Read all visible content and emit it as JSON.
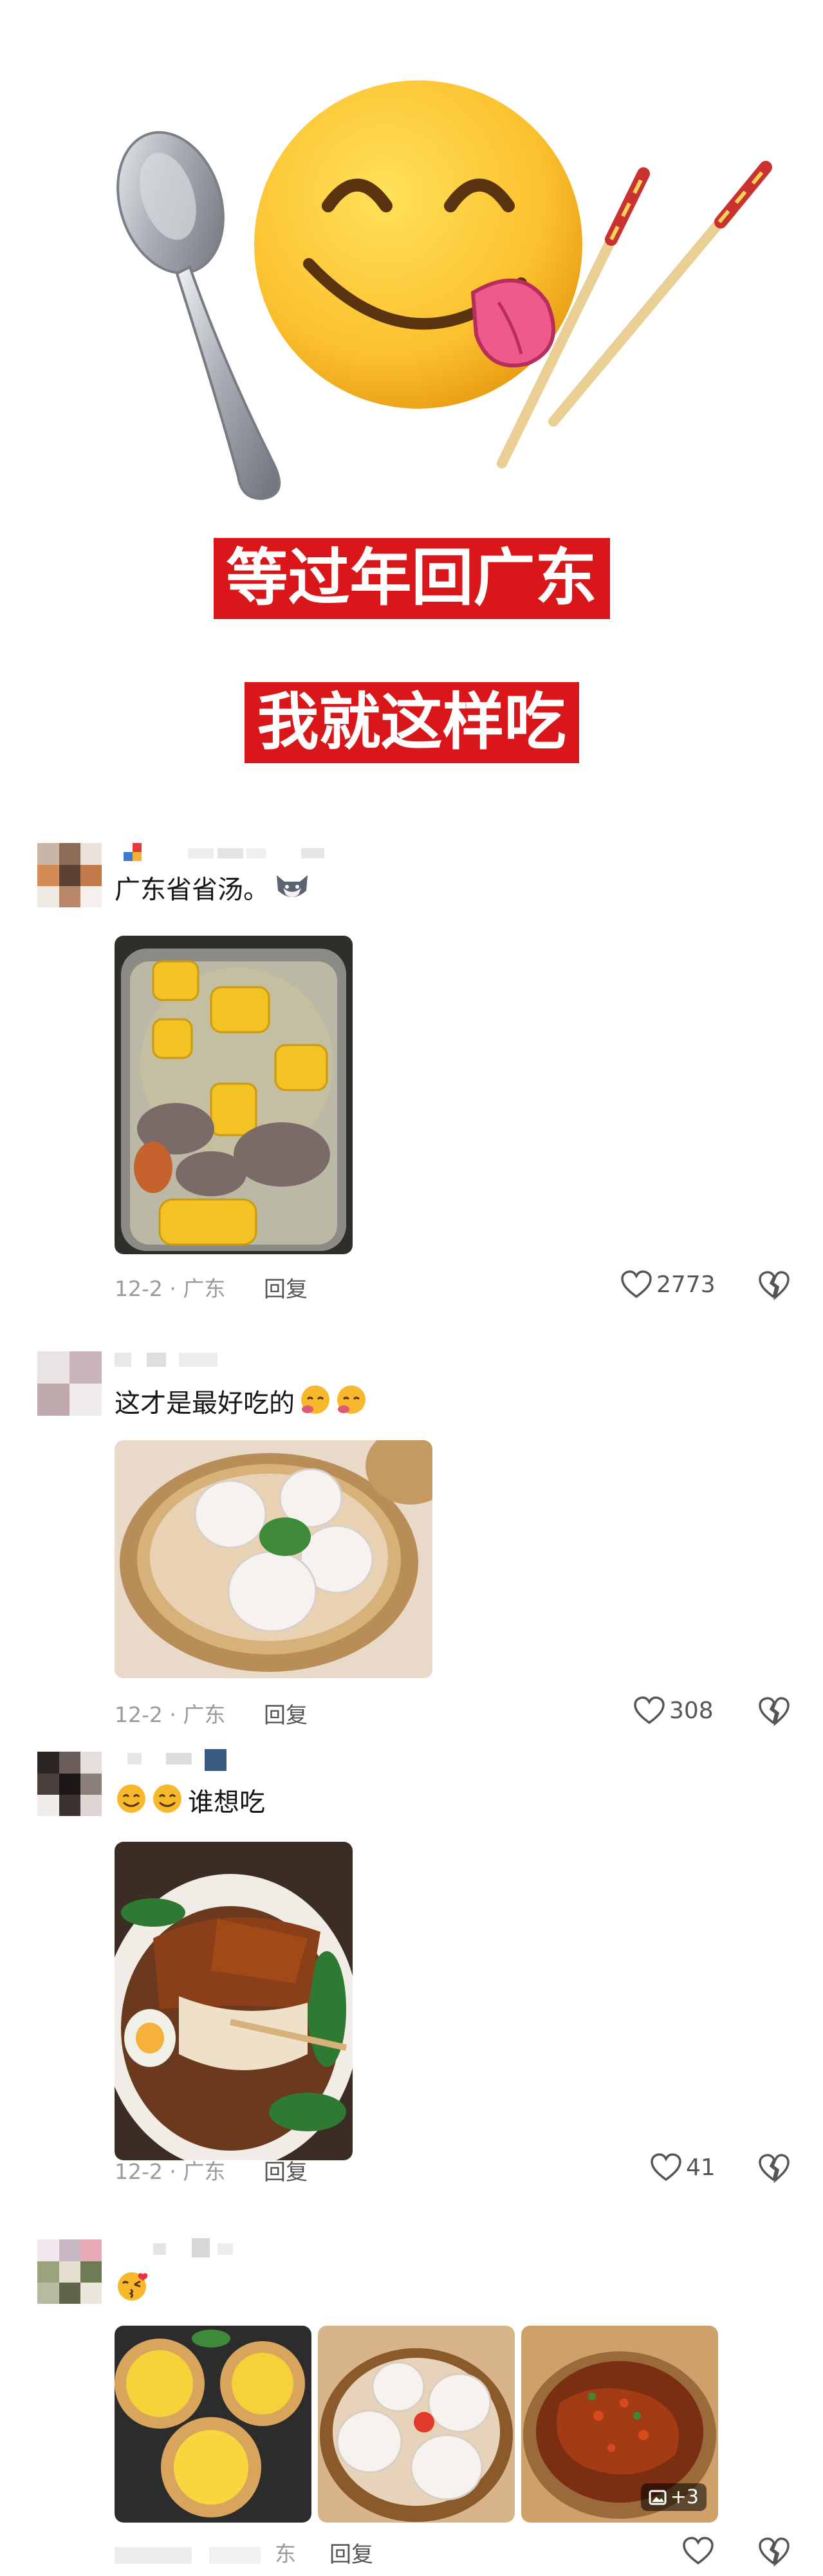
{
  "titles": [
    "等过年回广东",
    "我就这样吃"
  ],
  "colors": {
    "title_bg": "#d9161a",
    "meta": "#9a9a9a",
    "text": "#161616"
  },
  "comments": [
    {
      "text": "广东省省汤。",
      "date": "12-2 · 广东",
      "reply": "回复",
      "likes": "2773",
      "emoji": "cat-emoji"
    },
    {
      "text": "这才是最好吃的",
      "date": "12-2 · 广东",
      "reply": "回复",
      "likes": "308",
      "emoji": "hug-emoji"
    },
    {
      "text": "谁想吃",
      "date": "12-2 · 广东",
      "reply": "回复",
      "likes": "41",
      "emoji": "smile-emoji"
    },
    {
      "text": "",
      "date": "东",
      "reply": "回复",
      "likes": "",
      "emoji": "kiss-emoji",
      "more_count": "+3"
    }
  ]
}
